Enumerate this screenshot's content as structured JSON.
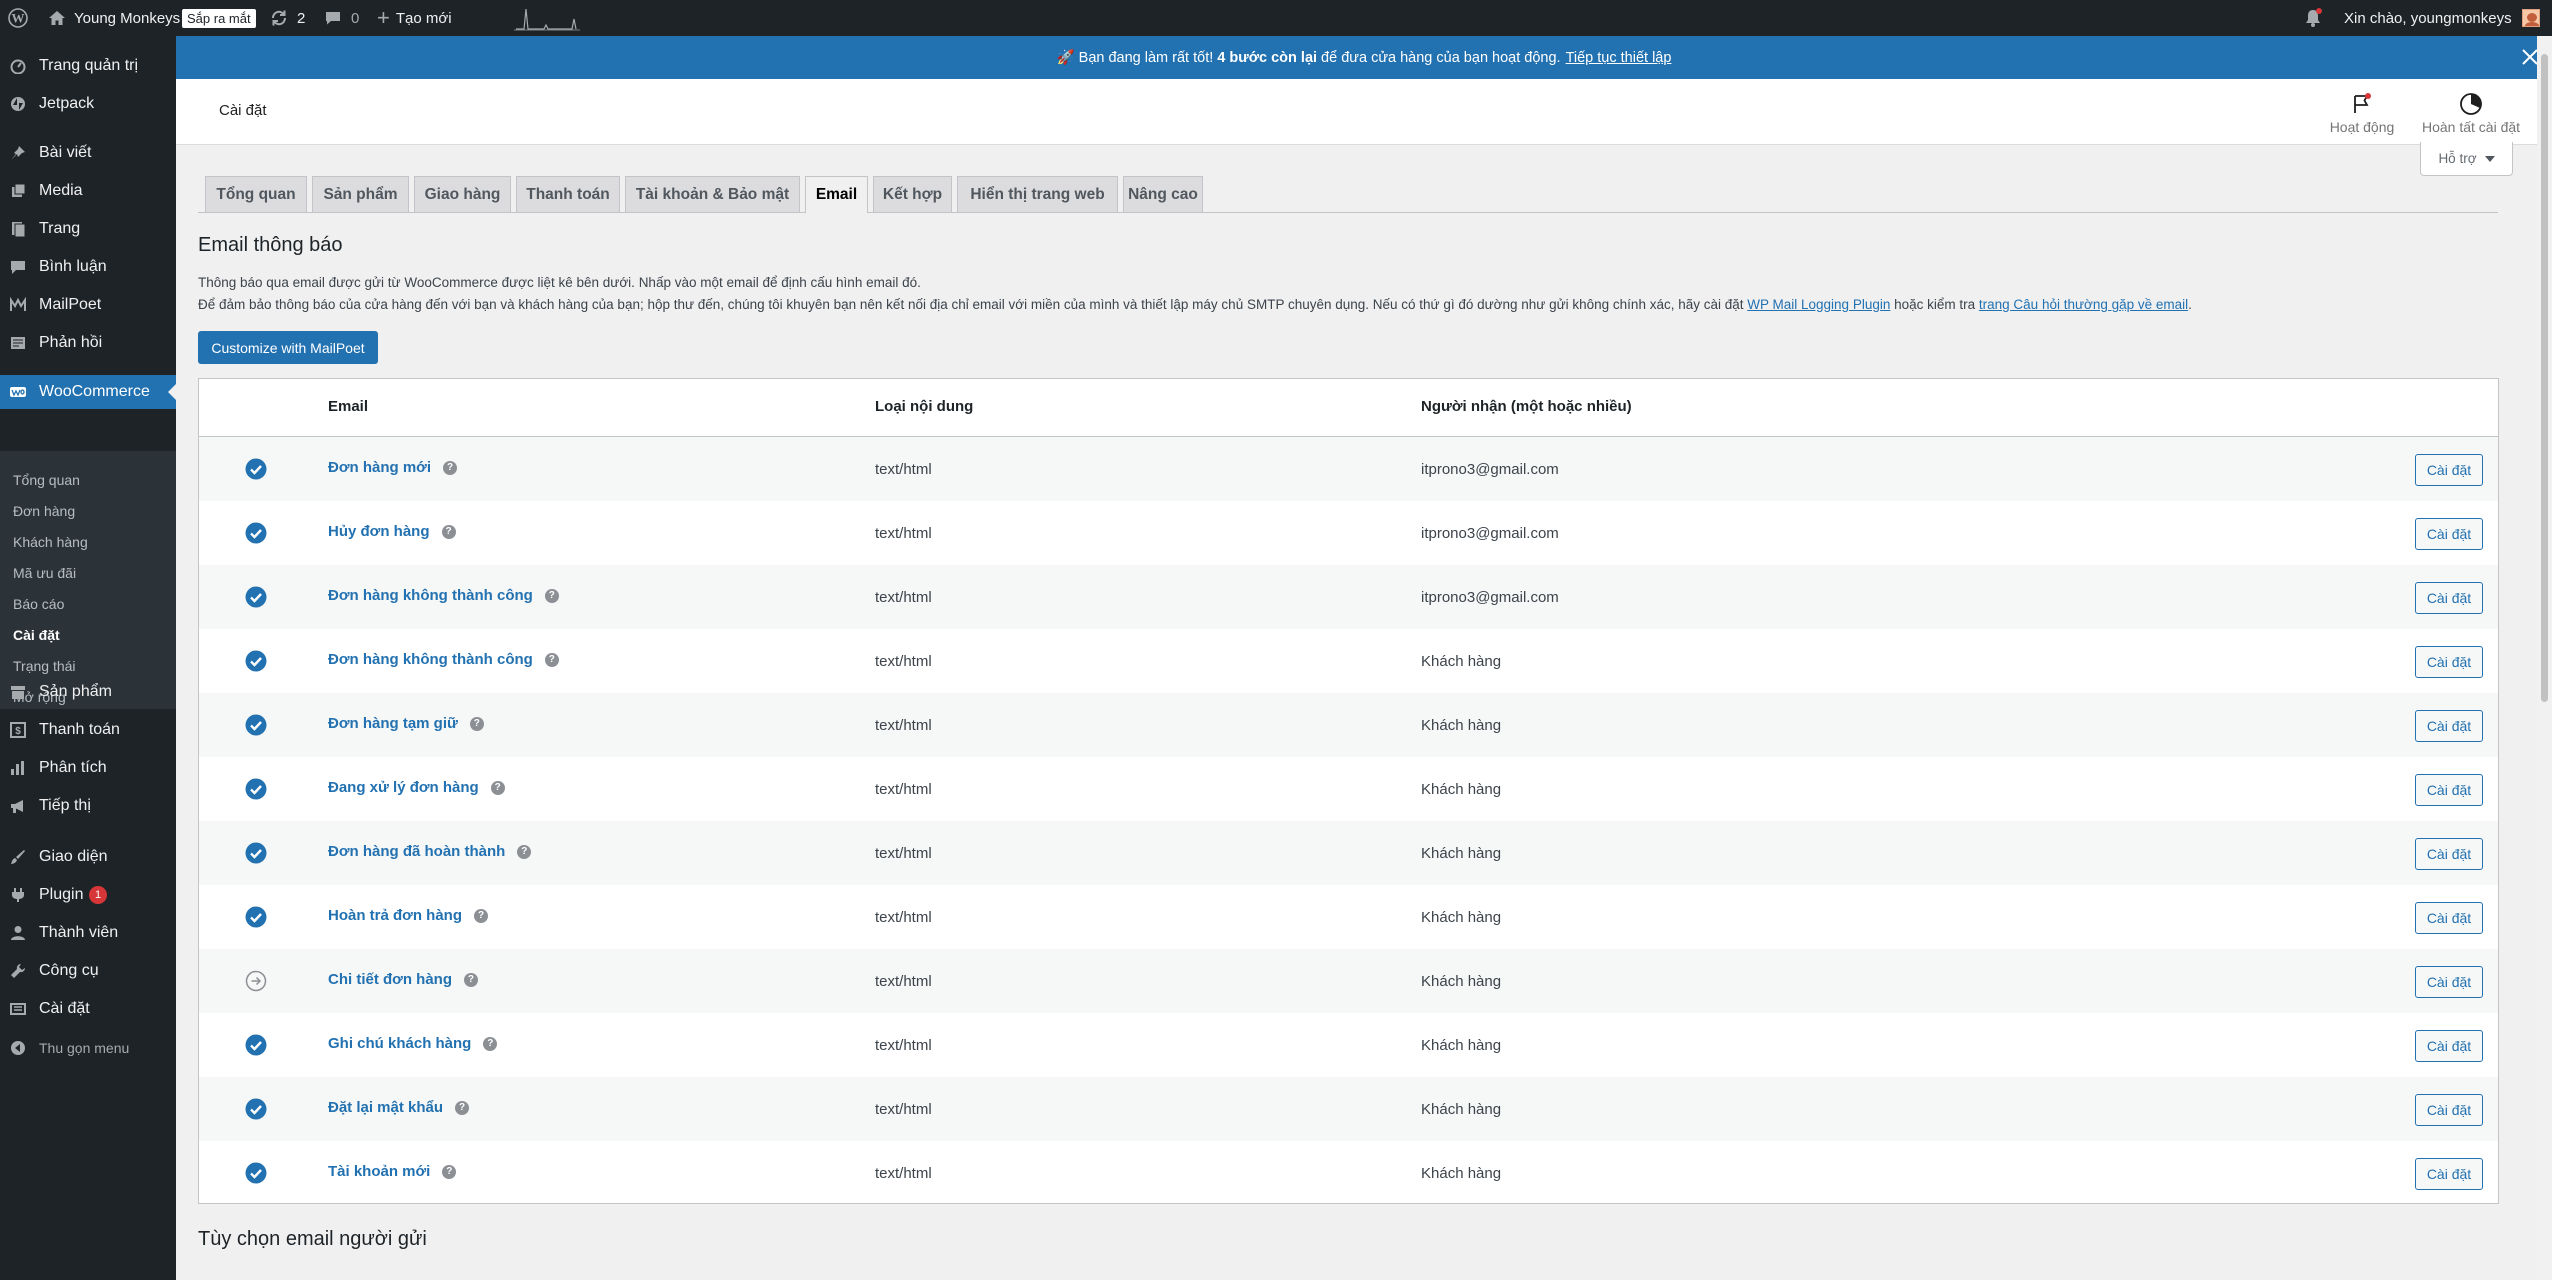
{
  "admin_bar": {
    "site_name": "Young Monkeys",
    "coming_soon": "Sắp ra mắt",
    "updates_count": "2",
    "comments_count": "0",
    "new_label": "Tạo mới",
    "greeting": "Xin chào, youngmonkeys"
  },
  "sidebar": {
    "items": [
      {
        "label": "Trang quản trị",
        "icon": "dashboard-icon"
      },
      {
        "label": "Jetpack",
        "icon": "jetpack-icon"
      },
      {
        "label": "Bài viết",
        "icon": "pin-icon"
      },
      {
        "label": "Media",
        "icon": "media-icon"
      },
      {
        "label": "Trang",
        "icon": "page-icon"
      },
      {
        "label": "Bình luận",
        "icon": "comment-icon"
      },
      {
        "label": "MailPoet",
        "icon": "mailpoet-icon"
      },
      {
        "label": "Phản hồi",
        "icon": "feedback-icon"
      },
      {
        "label": "WooCommerce",
        "icon": "woocommerce-icon"
      },
      {
        "label": "Sản phẩm",
        "icon": "archive-icon"
      },
      {
        "label": "Thanh toán",
        "icon": "payment-icon"
      },
      {
        "label": "Phân tích",
        "icon": "chart-icon"
      },
      {
        "label": "Tiếp thị",
        "icon": "megaphone-icon"
      },
      {
        "label": "Giao diện",
        "icon": "brush-icon"
      },
      {
        "label": "Plugin",
        "icon": "plugin-icon"
      },
      {
        "label": "Thành viên",
        "icon": "user-icon"
      },
      {
        "label": "Công cụ",
        "icon": "wrench-icon"
      },
      {
        "label": "Cài đặt",
        "icon": "settings-icon"
      },
      {
        "label": "Thu gọn menu",
        "icon": "collapse-icon"
      }
    ],
    "plugin_badge": "1",
    "woo_submenu": [
      "Tổng quan",
      "Đơn hàng",
      "Khách hàng",
      "Mã ưu đãi",
      "Báo cáo",
      "Cài đặt",
      "Trạng thái",
      "Mở rộng"
    ]
  },
  "notice": {
    "prefix": "🚀 Bạn đang làm rất tốt! ",
    "bold": "4 bước còn lại",
    "suffix": " để đưa cửa hàng của bạn hoạt động.",
    "link": "Tiếp tục thiết lập"
  },
  "header": {
    "title": "Cài đặt",
    "activity": "Hoạt động",
    "finish_setup": "Hoàn tất cài đặt",
    "help": "Hỗ trợ"
  },
  "tabs": [
    "Tổng quan",
    "Sản phẩm",
    "Giao hàng",
    "Thanh toán",
    "Tài khoản & Bảo mật",
    "Email",
    "Kết hợp",
    "Hiển thị trang web",
    "Nâng cao"
  ],
  "section": {
    "title": "Email thông báo",
    "desc1": "Thông báo qua email được gửi từ WooCommerce được liệt kê bên dưới. Nhấp vào một email để định cấu hình email đó.",
    "desc2_a": "Để đảm bảo thông báo của cửa hàng đến với bạn và khách hàng của bạn; hộp thư đến, chúng tôi khuyên bạn nên kết nối địa chỉ email với miền của mình và thiết lập máy chủ SMTP chuyên dụng. Nếu có thứ gì đó dường như gửi không chính xác, hãy cài đặt ",
    "desc2_link1": "WP Mail Logging Plugin",
    "desc2_b": " hoặc kiểm tra ",
    "desc2_link2": "trang Câu hỏi thường gặp về email",
    "desc2_c": ".",
    "mailpoet_button": "Customize with MailPoet"
  },
  "table": {
    "headers": {
      "email": "Email",
      "content": "Loại nội dung",
      "recipient": "Người nhận (một hoặc nhiều)"
    },
    "rows": [
      {
        "name": "Đơn hàng mới",
        "content": "text/html",
        "recipient": "itprono3@gmail.com",
        "enabled": true,
        "action": "Cài đặt"
      },
      {
        "name": "Hủy đơn hàng",
        "content": "text/html",
        "recipient": "itprono3@gmail.com",
        "enabled": true,
        "action": "Cài đặt"
      },
      {
        "name": "Đơn hàng không thành công",
        "content": "text/html",
        "recipient": "itprono3@gmail.com",
        "enabled": true,
        "action": "Cài đặt"
      },
      {
        "name": "Đơn hàng không thành công",
        "content": "text/html",
        "recipient": "Khách hàng",
        "enabled": true,
        "action": "Cài đặt"
      },
      {
        "name": "Đơn hàng tạm giữ",
        "content": "text/html",
        "recipient": "Khách hàng",
        "enabled": true,
        "action": "Cài đặt"
      },
      {
        "name": "Đang xử lý đơn hàng",
        "content": "text/html",
        "recipient": "Khách hàng",
        "enabled": true,
        "action": "Cài đặt"
      },
      {
        "name": "Đơn hàng đã hoàn thành",
        "content": "text/html",
        "recipient": "Khách hàng",
        "enabled": true,
        "action": "Cài đặt"
      },
      {
        "name": "Hoàn trả đơn hàng",
        "content": "text/html",
        "recipient": "Khách hàng",
        "enabled": true,
        "action": "Cài đặt"
      },
      {
        "name": "Chi tiết đơn hàng",
        "content": "text/html",
        "recipient": "Khách hàng",
        "enabled": false,
        "action": "Cài đặt"
      },
      {
        "name": "Ghi chú khách hàng",
        "content": "text/html",
        "recipient": "Khách hàng",
        "enabled": true,
        "action": "Cài đặt"
      },
      {
        "name": "Đặt lại mật khẩu",
        "content": "text/html",
        "recipient": "Khách hàng",
        "enabled": true,
        "action": "Cài đặt"
      },
      {
        "name": "Tài khoản mới",
        "content": "text/html",
        "recipient": "Khách hàng",
        "enabled": true,
        "action": "Cài đặt"
      }
    ]
  },
  "sender_section": {
    "title": "Tùy chọn email người gửi"
  },
  "colors": {
    "accent": "#2271b1",
    "admin_dark": "#1d2327",
    "badge": "#d63638"
  }
}
